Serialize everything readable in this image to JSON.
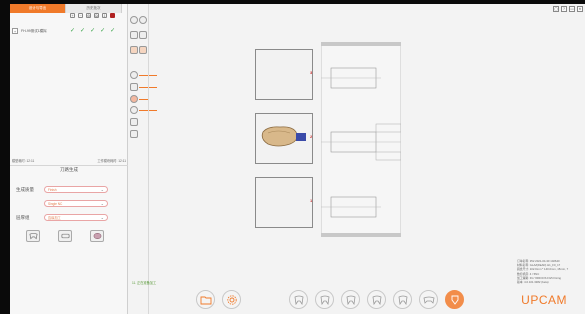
{
  "left_panel": {
    "tabs": [
      {
        "label": "设计与导出",
        "active": true
      },
      {
        "label": "历史批次",
        "active": false
      }
    ],
    "tree": {
      "item_label": "FH-99测试1模拟",
      "checks": [
        "✓",
        "✓",
        "✓",
        "✓",
        "✓"
      ]
    },
    "status": {
      "left": "模型耗时: 12:11",
      "right": "工作模块耗时: 12:11"
    },
    "section_title": "刀路生成",
    "fields": [
      {
        "label": "生成质量",
        "value": "Finish"
      },
      {
        "label": "",
        "value": "Single NC"
      },
      {
        "label": "层厚组",
        "value": "边缘加工"
      }
    ]
  },
  "window": {
    "icons": [
      "▢",
      "?",
      "▭",
      "✕"
    ]
  },
  "canvas": {
    "slots": [
      "3",
      "2",
      "1"
    ]
  },
  "info": {
    "lines": [
      "订单名称: 352 2021-04-30 102640",
      "材料名称: GLAZ(FEAD) H1_F0_17",
      "圆盘尺寸: 102.0mm * 140.0mm, 15mm, 7",
      "数控机床: 4 / 5NC",
      "加工策略: FG YRROOS FG5 Fixing",
      "版本: 4.0.101.3382 (beta)"
    ]
  },
  "hint": "11. 正在准备加工",
  "logo": "UPCAM",
  "colors": {
    "accent": "#f07a2a",
    "check": "#3aa34a"
  }
}
